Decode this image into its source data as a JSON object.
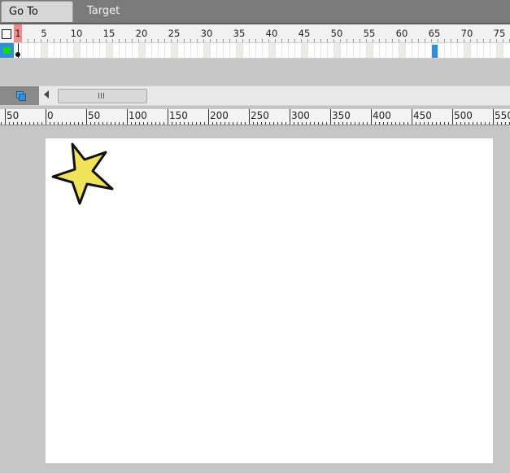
{
  "tabs": [
    {
      "label": "Go To Movie",
      "active": true
    },
    {
      "label": "Target",
      "active": false
    }
  ],
  "timeline": {
    "frame_numbers": [
      "1",
      "5",
      "10",
      "15",
      "20",
      "25",
      "30",
      "35",
      "40",
      "45",
      "50",
      "55",
      "60",
      "65",
      "70",
      "75"
    ],
    "current_frame": "1",
    "marker_frame": "65"
  },
  "stage_ruler": {
    "labels": [
      "50",
      "0",
      "50",
      "100",
      "150",
      "200",
      "250",
      "300",
      "350",
      "400",
      "450",
      "500",
      "550"
    ]
  },
  "colors": {
    "star_fill": "#f0e35b",
    "star_stroke": "#111111",
    "marker": "#2f8fd8",
    "playhead": "#f28c8c",
    "layer_dot": "#19d619"
  },
  "icons": {
    "stage_box": "square-outline-icon",
    "layers": "layers-icon",
    "scroll_left": "chevron-left-icon",
    "thumb_grip": "grip-icon"
  }
}
